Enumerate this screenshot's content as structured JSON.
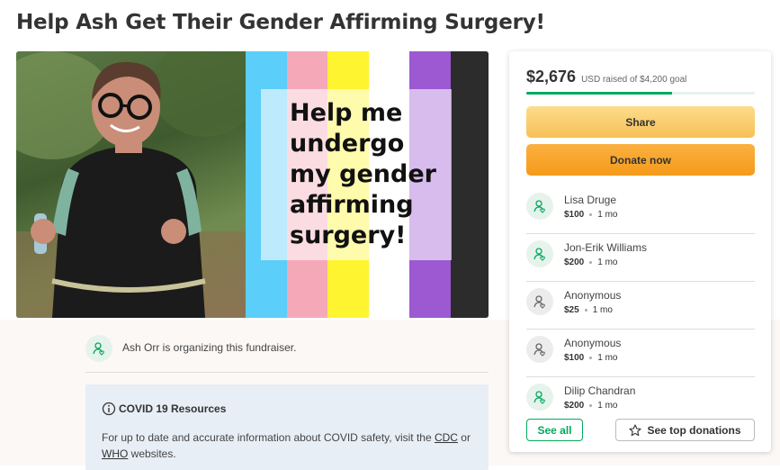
{
  "campaign": {
    "title": "Help Ash Get Their Gender Affirming Surgery!",
    "image_text": "Help me undergo my gender affirming surgery!"
  },
  "colors": {
    "accent_green": "#02a95c",
    "share_button": "#f7c056",
    "donate_button": "#f49b1a",
    "covid_panel": "#e8eef6",
    "flag_stripes": [
      "#5bcefa",
      "#f5a9b8",
      "#fff430",
      "#ffffff",
      "#9c59d1",
      "#2c2c2c"
    ]
  },
  "organizer": {
    "text": "Ash Orr is organizing this fundraiser.",
    "icon": "person-heart-icon"
  },
  "covid": {
    "title": "COVID 19 Resources",
    "icon": "info-circle-icon",
    "body_prefix": "For up to date and accurate information about COVID safety, visit the ",
    "link_cdc": "CDC",
    "body_mid": " or ",
    "link_who": "WHO",
    "body_suffix": " websites."
  },
  "sidebar": {
    "amount_raised": "$2,676",
    "goal_text": "USD raised of $4,200 goal",
    "progress_fraction": 0.637,
    "share_label": "Share",
    "donate_label": "Donate now",
    "see_all_label": "See all",
    "top_donations_label": "See top donations",
    "donations": [
      {
        "name": "Lisa Druge",
        "amount": "$100",
        "time": "1 mo",
        "icon": "person-heart-icon"
      },
      {
        "name": "Jon-Erik Williams",
        "amount": "$200",
        "time": "1 mo",
        "icon": "person-heart-icon"
      },
      {
        "name": "Anonymous",
        "amount": "$25",
        "time": "1 mo",
        "icon": "person-heart-icon-grey"
      },
      {
        "name": "Anonymous",
        "amount": "$100",
        "time": "1 mo",
        "icon": "person-heart-icon-grey"
      },
      {
        "name": "Dilip Chandran",
        "amount": "$200",
        "time": "1 mo",
        "icon": "person-heart-icon"
      }
    ]
  }
}
